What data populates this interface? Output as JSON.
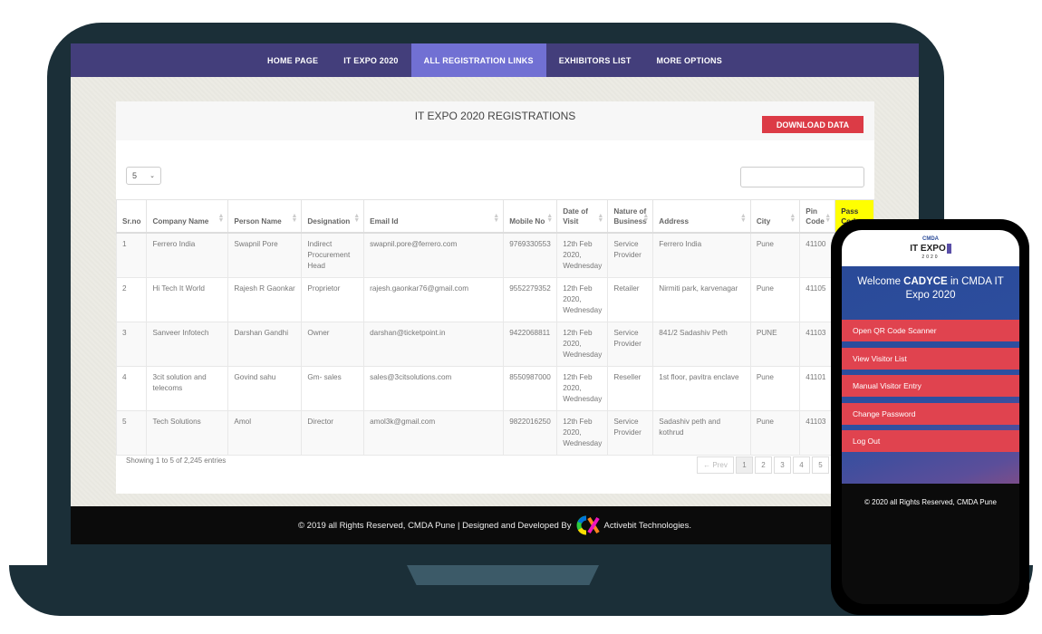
{
  "nav": {
    "items": [
      {
        "label": "HOME PAGE",
        "active": false
      },
      {
        "label": "IT EXPO 2020",
        "active": false
      },
      {
        "label": "ALL REGISTRATION LINKS",
        "active": true
      },
      {
        "label": "EXHIBITORS LIST",
        "active": false
      },
      {
        "label": "MORE OPTIONS",
        "active": false
      }
    ]
  },
  "panel": {
    "title": "IT EXPO 2020 REGISTRATIONS",
    "download_label": "DOWNLOAD DATA",
    "page_length": "5",
    "search_value": ""
  },
  "table": {
    "columns": [
      "Sr.no",
      "Company Name",
      "Person Name",
      "Designation",
      "Email Id",
      "Mobile No",
      "Date of Visit",
      "Nature of Business",
      "Address",
      "City",
      "Pin Code",
      "Pass Code"
    ],
    "rows": [
      [
        "1",
        "Ferrero India",
        "Swapnil Pore",
        "Indirect Procurement Head",
        "swapnil.pore@ferrero.com",
        "9769330553",
        "12th Feb 2020, Wednesday",
        "Service Provider",
        "Ferrero India",
        "Pune",
        "41100",
        ""
      ],
      [
        "2",
        "Hi Tech It World",
        "Rajesh R Gaonkar",
        "Proprietor",
        "rajesh.gaonkar76@gmail.com",
        "9552279352",
        "12th Feb 2020, Wednesday",
        "Retailer",
        "Nirmiti park, karvenagar",
        "Pune",
        "41105",
        ""
      ],
      [
        "3",
        "Sanveer Infotech",
        "Darshan Gandhi",
        "Owner",
        "darshan@ticketpoint.in",
        "9422068811",
        "12th Feb 2020, Wednesday",
        "Service Provider",
        "841/2 Sadashiv Peth",
        "PUNE",
        "41103",
        ""
      ],
      [
        "4",
        "3cit solution and telecoms",
        "Govind sahu",
        "Gm- sales",
        "sales@3citsolutions.com",
        "8550987000",
        "12th Feb 2020, Wednesday",
        "Reseller",
        "1st floor, pavitra enclave",
        "Pune",
        "41101",
        ""
      ],
      [
        "5",
        "Tech Solutions",
        "Amol",
        "Director",
        "amol3k@gmail.com",
        "9822016250",
        "12th Feb 2020, Wednesday",
        "Service Provider",
        "Sadashiv peth and kothrud",
        "Pune",
        "41103",
        ""
      ]
    ],
    "info": "Showing 1 to 5 of 2,245 entries",
    "pagination": {
      "prev": "← Prev",
      "pages": [
        "1",
        "2",
        "3",
        "4",
        "5"
      ],
      "current": "1"
    }
  },
  "footer": {
    "text": "© 2019 all Rights Reserved, CMDA Pune | Designed and Developed By",
    "company": "Activebit Technologies."
  },
  "phone": {
    "logo_top": "CMDA",
    "logo_main": "IT EXPO",
    "logo_year": "2020",
    "welcome_prefix": "Welcome",
    "welcome_user": "CADYCE",
    "welcome_suffix": "in CMDA IT Expo 2020",
    "buttons": [
      "Open QR Code Scanner",
      "View Visitor List",
      "Manual Visitor Entry",
      "Change Password",
      "Log Out"
    ],
    "footer": "© 2020 all Rights Reserved, CMDA Pune"
  },
  "colors": {
    "nav_bg": "#433e7b",
    "nav_active": "#7170d3",
    "accent_red": "#dc3b46",
    "device_frame": "#1b2f38",
    "pass_code_header": "#ffff00"
  }
}
